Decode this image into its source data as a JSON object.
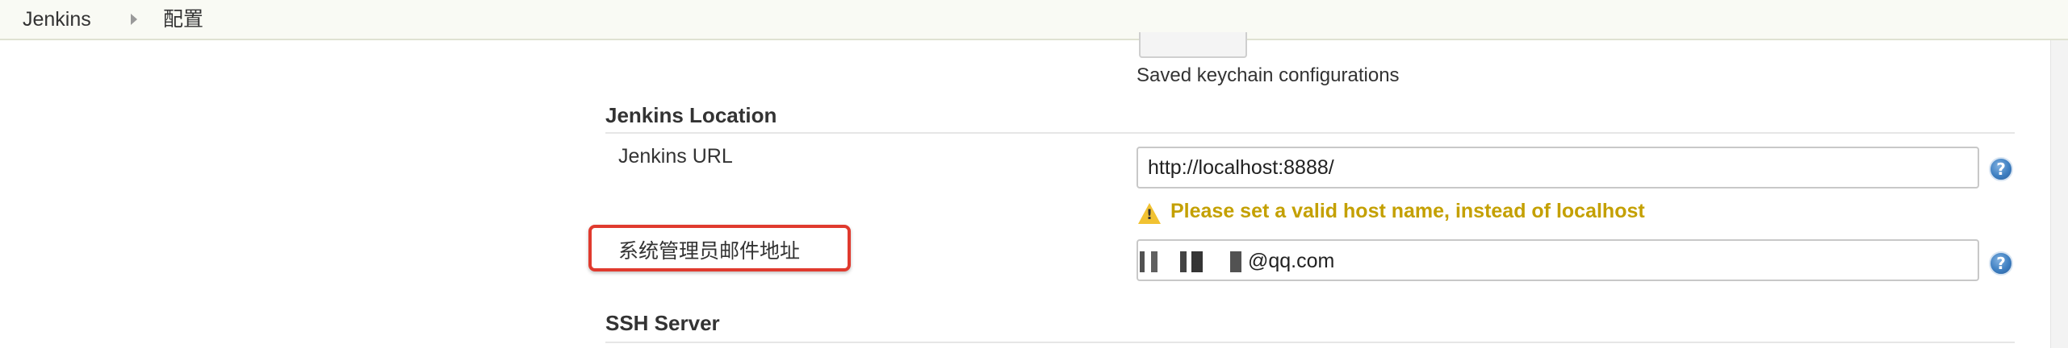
{
  "breadcrumb": {
    "items": [
      "Jenkins",
      "配置"
    ]
  },
  "keychain": {
    "saved_text": "Saved keychain configurations"
  },
  "jenkins_location": {
    "title": "Jenkins Location",
    "url_label": "Jenkins URL",
    "url_value": "http://localhost:8888/",
    "warning_text": "Please set a valid host name, instead of localhost",
    "email_label": "系统管理员邮件地址",
    "email_value_visible": "@qq.com"
  },
  "ssh_server": {
    "title": "SSH Server"
  },
  "icons": {
    "help_glyph": "?",
    "warning_glyph": "!"
  },
  "colors": {
    "warning_text": "#c4a000",
    "highlight_border": "#e03a2e",
    "help_icon": "#3e7fc1",
    "breadcrumb_bg": "#f9faf4"
  }
}
